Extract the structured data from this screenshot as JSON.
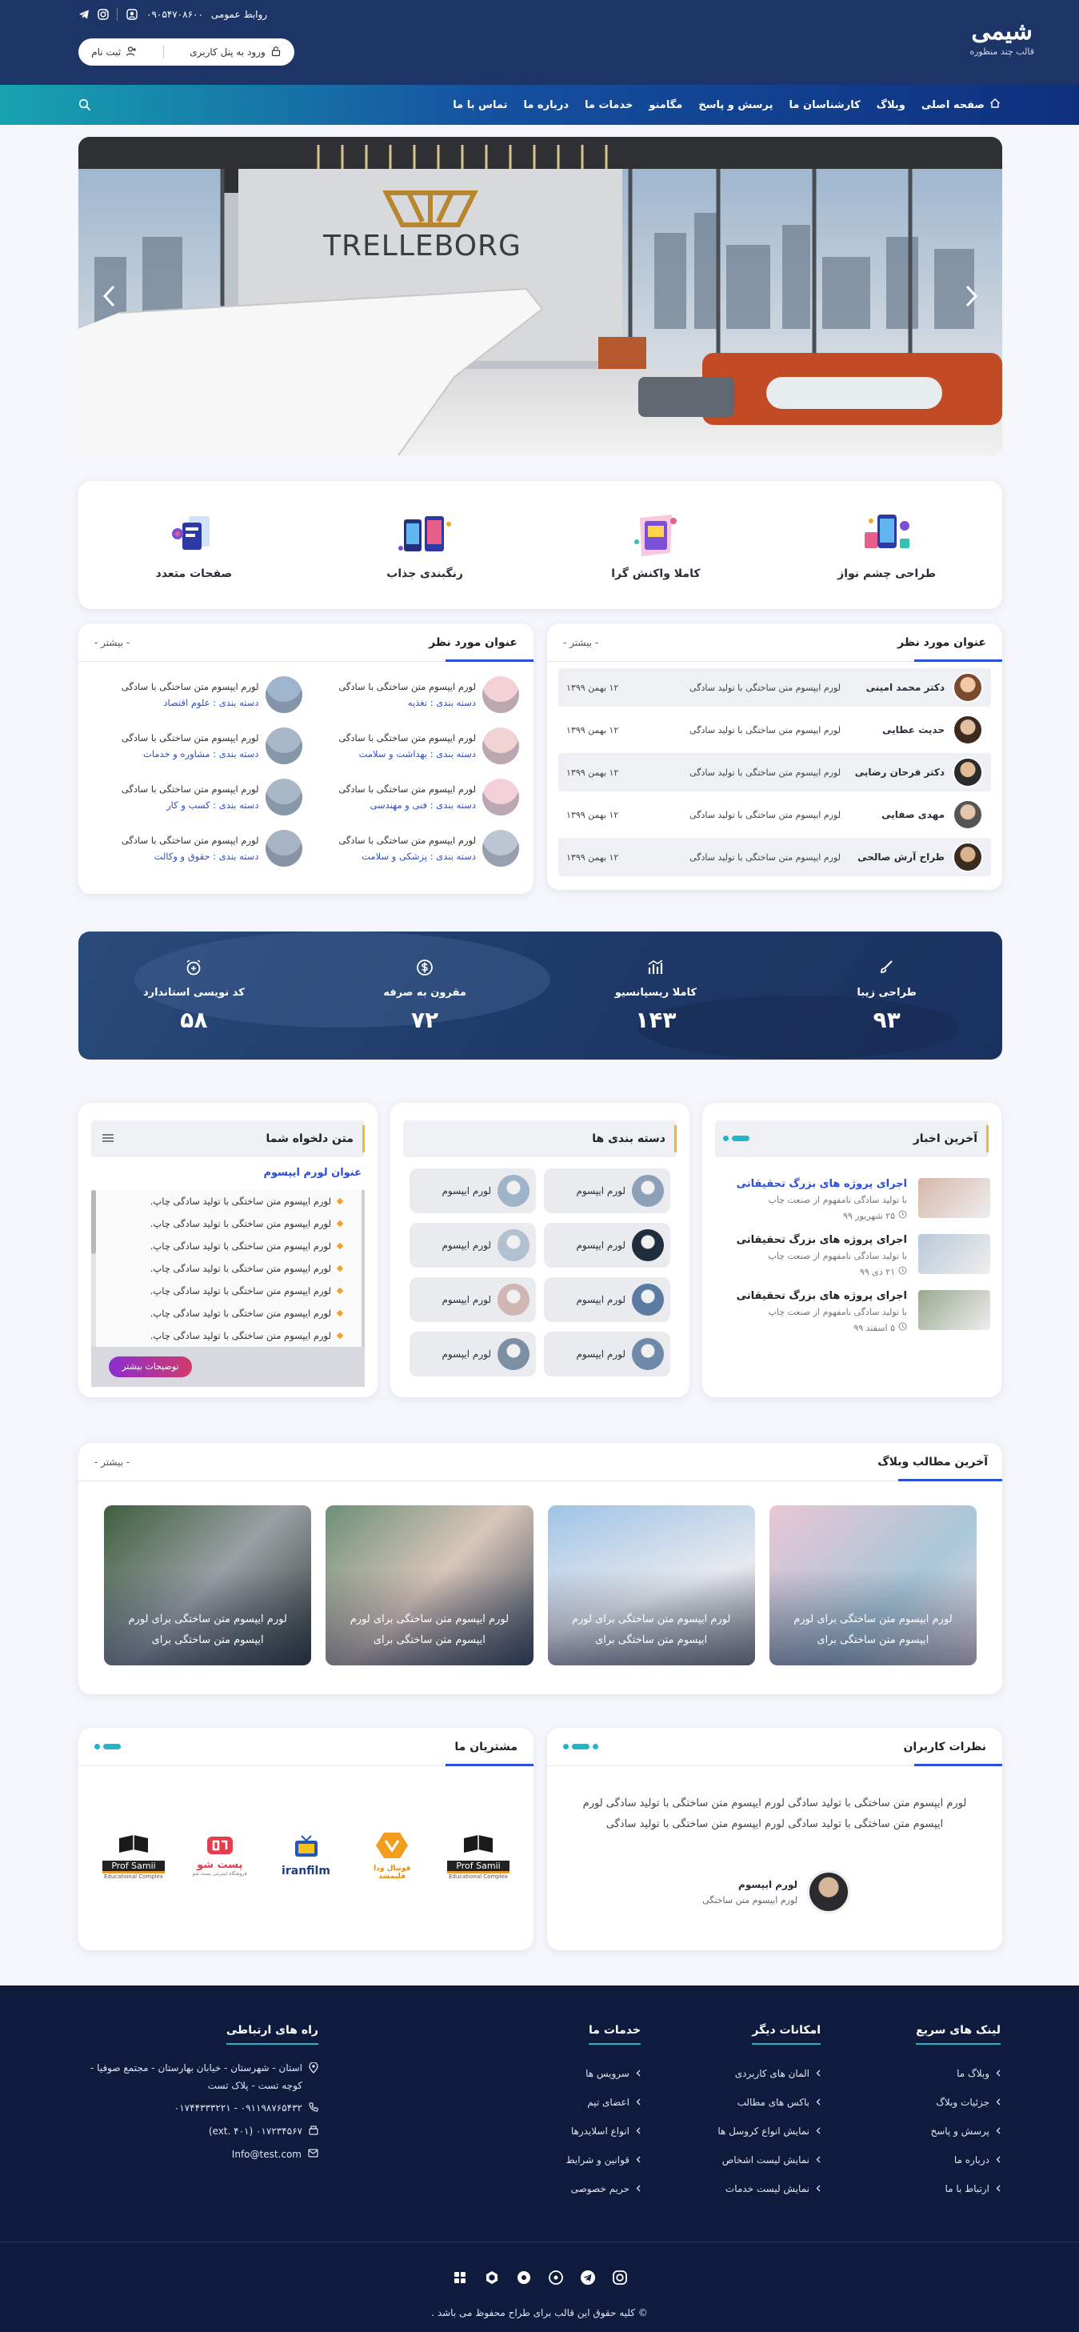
{
  "topbar": {
    "phone_label": "روابط عمومی",
    "phone": "۰۹۰۵۴۷۰۸۶۰۰",
    "login_label": "ورود به پنل کاربری",
    "register_label": "ثبت نام"
  },
  "brand": {
    "name": "شیمی",
    "tagline": "قالب چند منظوره"
  },
  "nav": {
    "items": [
      "صفحه اصلی",
      "وبلاگ",
      "کارشناسان ما",
      "پرسش و پاسخ",
      "مگامنو",
      "خدمات ما",
      "درباره ما",
      "تماس با ما"
    ]
  },
  "slider": {
    "sign_text": "TRELLEBORG"
  },
  "features": [
    {
      "label": "طراحی چشم نواز",
      "icon": "phone-illustration-icon"
    },
    {
      "label": "کاملا واکنش گرا",
      "icon": "responsive-illustration-icon"
    },
    {
      "label": "رنگبندی جذاب",
      "icon": "devices-illustration-icon"
    },
    {
      "label": "صفحات متعدد",
      "icon": "pages-illustration-icon"
    }
  ],
  "people_panel": {
    "title": "عنوان مورد نظر",
    "more": "- بیشتر -",
    "rows": [
      {
        "name": "دکتر محمد امینی",
        "desc": "لورم ایپسوم متن ساختگی با تولید سادگی",
        "date": "۱۲ بهمن ۱۳۹۹"
      },
      {
        "name": "حدیث عطایی",
        "desc": "لورم ایپسوم متن ساختگی با تولید سادگی",
        "date": "۱۲ بهمن ۱۳۹۹"
      },
      {
        "name": "دکتر فرحان رضایی",
        "desc": "لورم ایپسوم متن ساختگی با تولید سادگی",
        "date": "۱۲ بهمن ۱۳۹۹"
      },
      {
        "name": "مهدی صفایی",
        "desc": "لورم ایپسوم متن ساختگی با تولید سادگی",
        "date": "۱۲ بهمن ۱۳۹۹"
      },
      {
        "name": "طراح آرش صالحی",
        "desc": "لورم ایپسوم متن ساختگی با تولید سادگی",
        "date": "۱۲ بهمن ۱۳۹۹"
      }
    ]
  },
  "cats_panel": {
    "title": "عنوان مورد نظر",
    "more": "- بیشتر -",
    "items": [
      {
        "title": "لورم ایپسوم متن ساختگی با سادگی",
        "cat": "دسته بندی : تغذیه"
      },
      {
        "title": "لورم ایپسوم متن ساختگی با سادگی",
        "cat": "دسته بندی : علوم اقتصاد"
      },
      {
        "title": "لورم ایپسوم متن ساختگی با سادگی",
        "cat": "دسته بندی : بهداشت و سلامت"
      },
      {
        "title": "لورم ایپسوم متن ساختگی با سادگی",
        "cat": "دسته بندی : مشاوره و خدمات"
      },
      {
        "title": "لورم ایپسوم متن ساختگی با سادگی",
        "cat": "دسته بندی : فنی و مهندسی"
      },
      {
        "title": "لورم ایپسوم متن ساختگی با سادگی",
        "cat": "دسته بندی : کسب و کار"
      },
      {
        "title": "لورم ایپسوم متن ساختگی با سادگی",
        "cat": "دسته بندی : پزشکی و سلامت"
      },
      {
        "title": "لورم ایپسوم متن ساختگی با سادگی",
        "cat": "دسته بندی : حقوق و وکالت"
      }
    ]
  },
  "stats": [
    {
      "label": "طراحی زیبا",
      "value": "۹۳",
      "icon": "brush-icon"
    },
    {
      "label": "کاملا ریسپانسیو",
      "value": "۱۴۳",
      "icon": "chart-icon"
    },
    {
      "label": "مقرون به صرفه",
      "value": "۷۲",
      "icon": "dollar-icon"
    },
    {
      "label": "کد نویسی استاندارد",
      "value": "۵۸",
      "icon": "alarm-icon"
    }
  ],
  "news": {
    "title": "آخرین اخبار",
    "items": [
      {
        "title": "اجرای پروژه های بزرگ تحقیقاتی",
        "desc": "با تولید سادگی نامفهوم از صنعت چاپ",
        "date": "۲۵ شهریور ۹۹",
        "highlight": true
      },
      {
        "title": "اجرای پروژه های بزرگ تحقیقاتی",
        "desc": "با تولید سادگی نامفهوم از صنعت چاپ",
        "date": "۲۱ دی ۹۹",
        "highlight": false
      },
      {
        "title": "اجرای پروژه های بزرگ تحقیقاتی",
        "desc": "با تولید سادگی نامفهوم از صنعت چاپ",
        "date": "۵ اسفند ۹۹",
        "highlight": false
      }
    ]
  },
  "categories": {
    "title": "دسته بندی ها",
    "items": [
      "لورم ایپسوم",
      "لورم ایپسوم",
      "لورم ایپسوم",
      "لورم ایپسوم",
      "لورم ایپسوم",
      "لورم ایپسوم",
      "لورم ایپسوم",
      "لورم ایپسوم"
    ]
  },
  "custom_text": {
    "title": "متن دلخواه شما",
    "subtitle": "عنوان لورم ایپسوم",
    "lines": [
      "لورم ایپسوم متن ساختگی با تولید سادگی چاپ.",
      "لورم ایپسوم متن ساختگی با تولید سادگی چاپ.",
      "لورم ایپسوم متن ساختگی با تولید سادگی چاپ.",
      "لورم ایپسوم متن ساختگی با تولید سادگی چاپ.",
      "لورم ایپسوم متن ساختگی با تولید سادگی چاپ.",
      "لورم ایپسوم متن ساختگی با تولید سادگی چاپ.",
      "لورم ایپسوم متن ساختگی با تولید سادگی چاپ."
    ],
    "button": "توضیحات بیشتر"
  },
  "blog": {
    "title": "آخرین مطالب وبلاگ",
    "more": "- بیشتر -",
    "posts": [
      {
        "title": "لورم ایپسوم متن ساختگی برای لورم ایپسوم متن ساختگی برای"
      },
      {
        "title": "لورم ایپسوم متن ساختگی برای لورم ایپسوم متن ساختگی برای"
      },
      {
        "title": "لورم ایپسوم متن ساختگی برای لورم ایپسوم متن ساختگی برای"
      },
      {
        "title": "لورم ایپسوم متن ساختگی برای لورم ایپسوم متن ساختگی برای"
      }
    ]
  },
  "testimonials": {
    "title": "نظرات کاربران",
    "text": "لورم ایپسوم متن ساختگی با تولید سادگی لورم ایپسوم متن ساختگی با تولید سادگی لورم ایپسوم متن ساختگی با تولید سادگی لورم ایپسوم متن ساختگی با تولید سادگی",
    "name": "لورم ایپسوم",
    "role": "لورم ایپسوم متن ساختگی"
  },
  "customers": {
    "title": "مشتریان ما",
    "logos": [
      {
        "main": "Prof Samii",
        "sub": "Educational Complex"
      },
      {
        "main": "فوتبال ودا فلیمشد",
        "sub": ""
      },
      {
        "main": "iranfilm",
        "sub": ""
      },
      {
        "main": "پست شو",
        "sub": "فروشگاه اینترنتی پست شو"
      },
      {
        "main": "Prof Samii",
        "sub": "Educational Complex"
      }
    ]
  },
  "footer": {
    "cols": [
      {
        "title": "لینک های سریع",
        "items": [
          "وبلاگ ما",
          "جزئیات وبلاگ",
          "پرسش و پاسخ",
          "درباره ما",
          "ارتباط با ما"
        ]
      },
      {
        "title": "امکانات دیگر",
        "items": [
          "المان های کاربردی",
          "باکس های مطالب",
          "نمایش انواع کروسل ها",
          "نمایش لیست اشخاص",
          "نمایش لیست خدمات"
        ]
      },
      {
        "title": "خدمات ما",
        "items": [
          "سرویس ها",
          "اعضای تیم",
          "انواع اسلایدرها",
          "قوانین و شرایط",
          "حریم خصوصی"
        ]
      }
    ],
    "contact": {
      "title": "راه های ارتباطی",
      "address": "استان - شهرستان - خیابان بهارستان - مجتمع صوفیا - کوچه تست - پلاک تست",
      "phones": "۰۹۱۱۹۸۷۶۵۴۳۲ - ۰۱۷۴۴۳۳۳۲۲۱",
      "fax": "۰۱۷۲۳۴۵۶۷ (ext. ۴۰۱)",
      "email": "Info@test.com"
    },
    "copyright": "© کلیه حقوق این قالب برای طراح محفوظ می باشد ."
  },
  "colors": {
    "header": "#1d3566",
    "nav_start": "#0e2f7e",
    "nav_end": "#17a3b0",
    "accent": "#2a4ed8",
    "footer": "#0f1b3d",
    "badge": "#c93a74"
  }
}
